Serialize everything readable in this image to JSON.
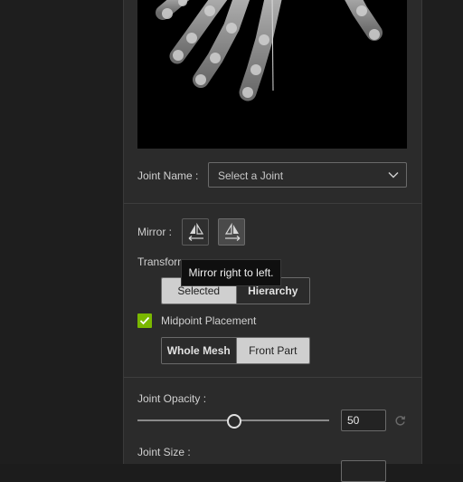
{
  "panel": {
    "joint_name_label": "Joint Name :",
    "joint_select": {
      "value": "Select a Joint",
      "icon": "chevron-down-icon"
    },
    "mirror_label": "Mirror :",
    "mirror_buttons": [
      {
        "icon": "mirror-left-icon",
        "active": false
      },
      {
        "icon": "mirror-right-icon",
        "active": true
      }
    ],
    "transform_label": "Transform",
    "tooltip": "Mirror right to left.",
    "transform_segment": [
      {
        "label": "Selected",
        "selected": true
      },
      {
        "label": "Hierarchy",
        "selected": false
      }
    ],
    "midpoint_checkbox": {
      "label": "Midpoint Placement",
      "checked": true
    },
    "mesh_segment": [
      {
        "label": "Whole Mesh",
        "selected": false
      },
      {
        "label": "Front Part",
        "selected": true
      }
    ],
    "joint_opacity_label": "Joint Opacity :",
    "joint_opacity_value": "50",
    "joint_opacity_fraction": 0.5,
    "joint_size_label": "Joint Size :"
  },
  "colors": {
    "panel_bg": "#2b2b2b",
    "checkbox_accent": "#7ab800",
    "segment_selected_bg": "#cfcfcf"
  }
}
